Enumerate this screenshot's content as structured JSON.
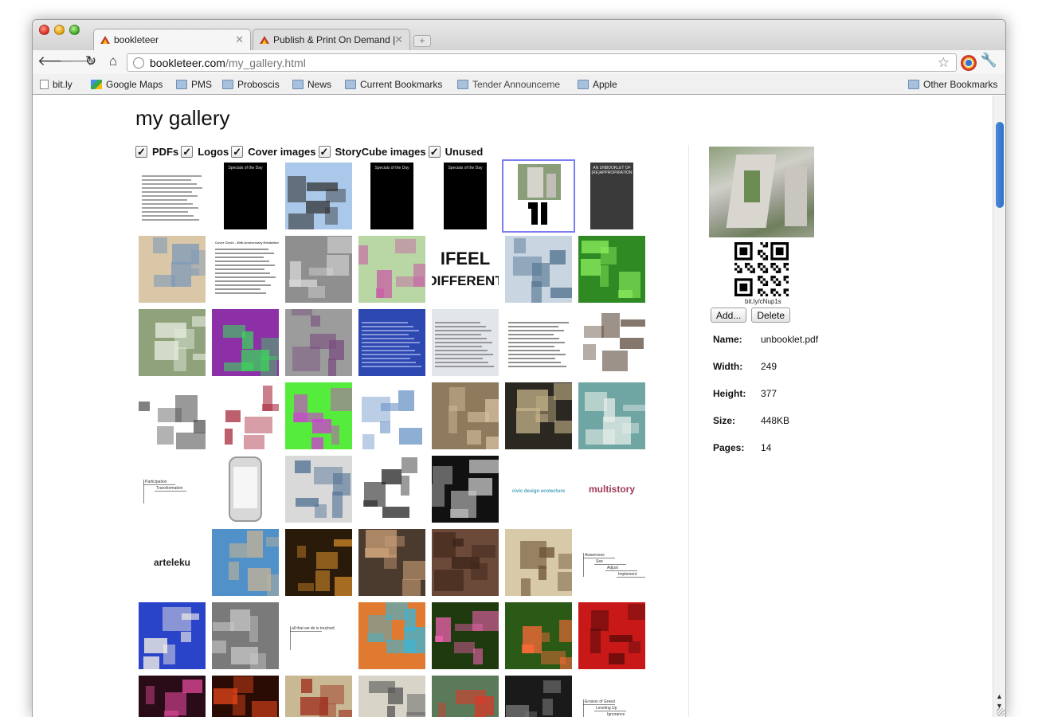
{
  "tabs": [
    {
      "title": "bookleteer",
      "active": true
    },
    {
      "title": "Publish & Print On Demand |",
      "active": false
    }
  ],
  "url": {
    "host": "bookleteer.com",
    "path": "/my_gallery.html"
  },
  "bookmarks": [
    {
      "label": "bit.ly",
      "icon": "page-icon"
    },
    {
      "label": "Google Maps",
      "icon": "google-maps-icon"
    },
    {
      "label": "PMS",
      "icon": "folder-icon"
    },
    {
      "label": "Proboscis",
      "icon": "folder-icon"
    },
    {
      "label": "News",
      "icon": "folder-icon"
    },
    {
      "label": "Current Bookmarks",
      "icon": "folder-icon"
    },
    {
      "label": "Tender Announceme",
      "icon": "folder-icon"
    },
    {
      "label": "Apple",
      "icon": "folder-icon"
    }
  ],
  "other_bookmarks": "Other Bookmarks",
  "page_title": "my gallery",
  "filters": [
    {
      "label": "PDFs",
      "checked": true
    },
    {
      "label": "Logos",
      "checked": true
    },
    {
      "label": "Cover images",
      "checked": true
    },
    {
      "label": "StoryCube images",
      "checked": true
    },
    {
      "label": "Unused",
      "checked": true
    }
  ],
  "gallery_rows": [
    [
      {
        "kind": "doc",
        "bg": "#ffffff",
        "fg": "#555555",
        "selected": false
      },
      {
        "kind": "poster",
        "bg": "#000000",
        "fg": "#dddddd",
        "text": "Specials of the Day",
        "selected": false
      },
      {
        "kind": "photo",
        "bg": "#a9c8ea",
        "fg": "#333333",
        "selected": false
      },
      {
        "kind": "poster",
        "bg": "#000000",
        "fg": "#dddddd",
        "text": "Specials of the Day",
        "selected": false
      },
      {
        "kind": "poster",
        "bg": "#000000",
        "fg": "#dddddd",
        "text": "Specials of the Day",
        "selected": false
      },
      {
        "kind": "qrcover",
        "bg": "#ffffff",
        "fg": "#000000",
        "selected": true
      },
      {
        "kind": "poster",
        "bg": "#3a3a3a",
        "fg": "#eeeeee",
        "text": "AN UNBOOKLET OF (RE)APPROPRIATION",
        "selected": false
      }
    ],
    [
      {
        "kind": "photo",
        "bg": "#d9c7a8",
        "fg": "#7e9ab8",
        "selected": false
      },
      {
        "kind": "doc",
        "bg": "#ffffff",
        "fg": "#444444",
        "text": "Cover Circle - 30th Anniversary Exhibition",
        "selected": false
      },
      {
        "kind": "photo",
        "bg": "#8f8f8f",
        "fg": "#d8d8d8",
        "selected": false
      },
      {
        "kind": "photo",
        "bg": "#b9d7a4",
        "fg": "#c85ea6",
        "selected": false
      },
      {
        "kind": "bigtext",
        "bg": "#ffffff",
        "fg": "#111111",
        "text": "IFEEL DIFFERENT",
        "selected": false
      },
      {
        "kind": "photo",
        "bg": "#c9d6e2",
        "fg": "#4e6f8c",
        "selected": false
      },
      {
        "kind": "photo",
        "bg": "#2f8a24",
        "fg": "#8ef05e",
        "selected": false
      }
    ],
    [
      {
        "kind": "photo",
        "bg": "#8fa27c",
        "fg": "#e7ede0",
        "selected": false
      },
      {
        "kind": "photo",
        "bg": "#8d2fa7",
        "fg": "#3bd65a",
        "selected": false
      },
      {
        "kind": "photo",
        "bg": "#9c9c9c",
        "fg": "#7a4d7f",
        "selected": false
      },
      {
        "kind": "doc",
        "bg": "#2d48b0",
        "fg": "#cfd8ff",
        "selected": false
      },
      {
        "kind": "doc",
        "bg": "#e2e6ea",
        "fg": "#555555",
        "selected": false
      },
      {
        "kind": "doc",
        "bg": "#ffffff",
        "fg": "#333333",
        "selected": false
      },
      {
        "kind": "photo",
        "bg": "#ffffff",
        "fg": "#5c4a3a",
        "selected": false
      }
    ],
    [
      {
        "kind": "photo",
        "bg": "#ffffff",
        "fg": "#555555",
        "selected": false
      },
      {
        "kind": "photo",
        "bg": "#ffffff",
        "fg": "#a8293c",
        "selected": false
      },
      {
        "kind": "photo",
        "bg": "#56ec3b",
        "fg": "#d23ad8",
        "selected": false
      },
      {
        "kind": "photo",
        "bg": "#ffffff",
        "fg": "#6a93c5",
        "selected": false
      },
      {
        "kind": "photo",
        "bg": "#8e7a5c",
        "fg": "#d4c2a0",
        "selected": false
      },
      {
        "kind": "photo",
        "bg": "#2b2822",
        "fg": "#c7b48a",
        "selected": false
      },
      {
        "kind": "photo",
        "bg": "#6fa6a4",
        "fg": "#e6ede8",
        "selected": false
      }
    ],
    [
      {
        "kind": "diagram",
        "bg": "#ffffff",
        "fg": "#333333",
        "text": "Participation  Transformation",
        "selected": false
      },
      {
        "kind": "phone",
        "bg": "#ffffff",
        "fg": "#9a9a9a",
        "selected": false
      },
      {
        "kind": "photo",
        "bg": "#d9d9d9",
        "fg": "#4e6f92",
        "selected": false
      },
      {
        "kind": "photo",
        "bg": "#ffffff",
        "fg": "#222222",
        "selected": false
      },
      {
        "kind": "photo",
        "bg": "#111111",
        "fg": "#cccccc",
        "selected": false
      },
      {
        "kind": "logo",
        "bg": "#ffffff",
        "fg": "#4aa3b8",
        "text": "civic design ecotecture",
        "selected": false
      },
      {
        "kind": "logo",
        "bg": "#ffffff",
        "fg": "#a03b58",
        "text": "multistory",
        "selected": false
      }
    ],
    [
      {
        "kind": "logo",
        "bg": "#ffffff",
        "fg": "#222222",
        "text": "arteleku",
        "selected": false
      },
      {
        "kind": "photo",
        "bg": "#4f91c8",
        "fg": "#c7b394",
        "selected": false
      },
      {
        "kind": "photo",
        "bg": "#2a1a0a",
        "fg": "#d08a2a",
        "selected": false
      },
      {
        "kind": "photo",
        "bg": "#4b3a2e",
        "fg": "#caa078",
        "selected": false
      },
      {
        "kind": "photo",
        "bg": "#6b4a3a",
        "fg": "#3b2417",
        "selected": false
      },
      {
        "kind": "photo",
        "bg": "#d8c9a8",
        "fg": "#6b5234",
        "selected": false
      },
      {
        "kind": "diagram",
        "bg": "#ffffff",
        "fg": "#333333",
        "text": "Awareness  See  Adjust  Implement",
        "selected": false
      }
    ],
    [
      {
        "kind": "photo",
        "bg": "#2a44c9",
        "fg": "#fff9e6",
        "selected": false
      },
      {
        "kind": "photo",
        "bg": "#7a7a7a",
        "fg": "#c8c8c8",
        "selected": false
      },
      {
        "kind": "diagram",
        "bg": "#ffffff",
        "fg": "#333333",
        "text": "all that we do is touched",
        "selected": false
      },
      {
        "kind": "photo",
        "bg": "#e07a30",
        "fg": "#3ab6d8",
        "selected": false
      },
      {
        "kind": "photo",
        "bg": "#1e3a0e",
        "fg": "#f062b0",
        "selected": false
      },
      {
        "kind": "photo",
        "bg": "#2b5a16",
        "fg": "#ff6a3a",
        "selected": false
      },
      {
        "kind": "photo",
        "bg": "#c81818",
        "fg": "#5a0a0a",
        "selected": false
      }
    ],
    [
      {
        "kind": "photo",
        "bg": "#2a0c18",
        "fg": "#e34a9c",
        "selected": false
      },
      {
        "kind": "photo",
        "bg": "#2a0c05",
        "fg": "#e6461a",
        "selected": false
      },
      {
        "kind": "photo",
        "bg": "#c8b894",
        "fg": "#9c2a1a",
        "selected": false
      },
      {
        "kind": "photo",
        "bg": "#d8d4c8",
        "fg": "#555555",
        "selected": false
      },
      {
        "kind": "photo",
        "bg": "#5a7a5a",
        "fg": "#d83a2a",
        "selected": false
      },
      {
        "kind": "photo",
        "bg": "#1a1a1a",
        "fg": "#7a7a7a",
        "selected": false
      },
      {
        "kind": "diagram",
        "bg": "#ffffff",
        "fg": "#333333",
        "text": "Erosion of Greed  Leveling Up  Ignorance",
        "selected": false
      }
    ]
  ],
  "detail": {
    "qr_label": "bit.ly/cNup1s",
    "add_label": "Add...",
    "delete_label": "Delete",
    "properties": [
      {
        "key": "Name:",
        "value": "unbooklet.pdf"
      },
      {
        "key": "Width:",
        "value": "249"
      },
      {
        "key": "Height:",
        "value": "377"
      },
      {
        "key": "Size:",
        "value": "448KB"
      },
      {
        "key": "Pages:",
        "value": "14"
      }
    ]
  },
  "colors": {
    "selection": "#7c7cf2",
    "scroll_thumb": "#2f6fc9"
  }
}
